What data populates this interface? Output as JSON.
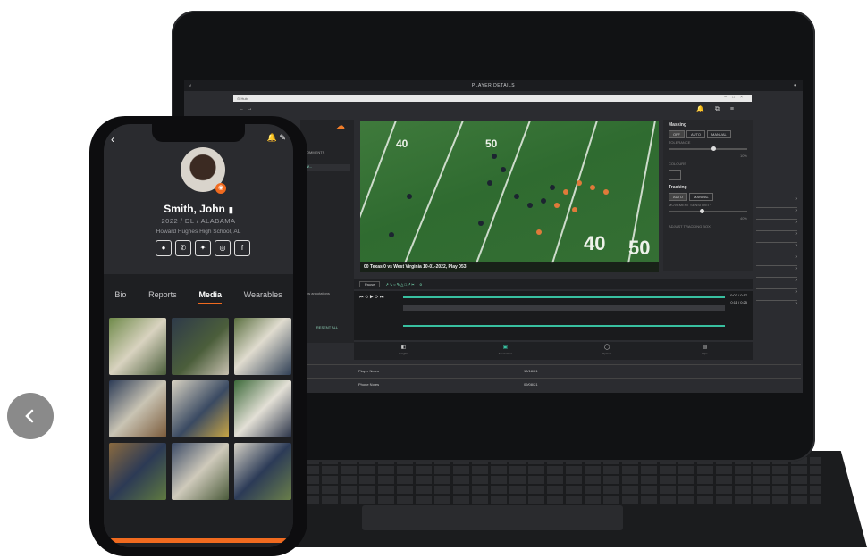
{
  "carousel": {
    "prev_icon": "chevron-left-icon"
  },
  "laptop": {
    "app_title": "PLAYER DETAILS",
    "browser_url": "⊙ Hub",
    "left_panel": {
      "tab": "COMMENTS",
      "row": "W...",
      "annotations": "ow annotations",
      "present": "RESENT ALL"
    },
    "video_caption": "00 Texas 0 vs West Virginia 10-01-2022, Play 053",
    "yard_numbers": [
      "40",
      "50",
      "40",
      "50"
    ],
    "right_panel": {
      "masking": {
        "title": "Masking",
        "options": [
          "OFF",
          "AUTO",
          "MANUAL"
        ],
        "tolerance_label": "TOLERANCE",
        "tolerance_value": "10%",
        "colours_label": "COLOURS"
      },
      "tracking": {
        "title": "Tracking",
        "options": [
          "AUTO",
          "MANUAL"
        ],
        "sensitivity_label": "MOVEMENT SENSITIVITY",
        "sensitivity_value": "40%",
        "adjust_label": "ADJUST TRACKING BOX"
      }
    },
    "toolbar": {
      "field": "Pause",
      "counter": "0"
    },
    "times": {
      "t1": "0:03 / 0:17",
      "t2": "0:11 / 0:25"
    },
    "bottom_nav": [
      {
        "label": "Insights"
      },
      {
        "label": "Annotations"
      },
      {
        "label": "Options"
      },
      {
        "label": "Clips"
      }
    ],
    "notes": [
      {
        "label": "Player Notes",
        "date": "10/18/21"
      },
      {
        "label": "Phone Notes",
        "date": "09/08/21"
      }
    ]
  },
  "phone": {
    "name": "Smith, John",
    "meta": "2022 / DL / ALABAMA",
    "school": "Howard Hughes High School, AL",
    "socials": [
      "message-icon",
      "phone-icon",
      "twitter-icon",
      "instagram-icon",
      "facebook-icon"
    ],
    "tabs": [
      {
        "label": "Bio",
        "active": false
      },
      {
        "label": "Reports",
        "active": false
      },
      {
        "label": "Media",
        "active": true
      },
      {
        "label": "Wearables",
        "active": false
      }
    ],
    "media_count": 9,
    "accent": "#f06a1f"
  }
}
